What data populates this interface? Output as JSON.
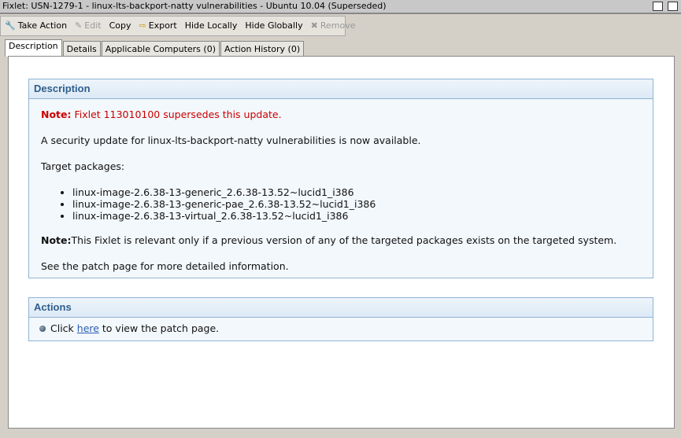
{
  "window": {
    "title": "Fixlet: USN-1279-1 - linux-lts-backport-natty vulnerabilities - Ubuntu 10.04 (Superseded)"
  },
  "toolbar": {
    "take_action": "Take Action",
    "edit": "Edit",
    "copy": "Copy",
    "export": "Export",
    "hide_locally": "Hide Locally",
    "hide_globally": "Hide Globally",
    "remove": "Remove"
  },
  "tabs": [
    "Description",
    "Details",
    "Applicable Computers (0)",
    "Action History (0)"
  ],
  "description": {
    "heading": "Description",
    "note_label": "Note:",
    "note_text": " Fixlet 113010100 supersedes this update.",
    "summary": "A security update for linux-lts-backport-natty vulnerabilities is now available.",
    "target_label": "Target packages:",
    "packages": [
      "linux-image-2.6.38-13-generic_2.6.38-13.52~lucid1_i386",
      "linux-image-2.6.38-13-generic-pae_2.6.38-13.52~lucid1_i386",
      "linux-image-2.6.38-13-virtual_2.6.38-13.52~lucid1_i386"
    ],
    "note2_label": "Note:",
    "note2_text": "This Fixlet is relevant only if a previous version of any of the targeted packages exists on the targeted system.",
    "see_more": "See the patch page for more detailed information."
  },
  "actions": {
    "heading": "Actions",
    "prefix": "Click ",
    "link": "here",
    "suffix": " to view the patch page."
  }
}
